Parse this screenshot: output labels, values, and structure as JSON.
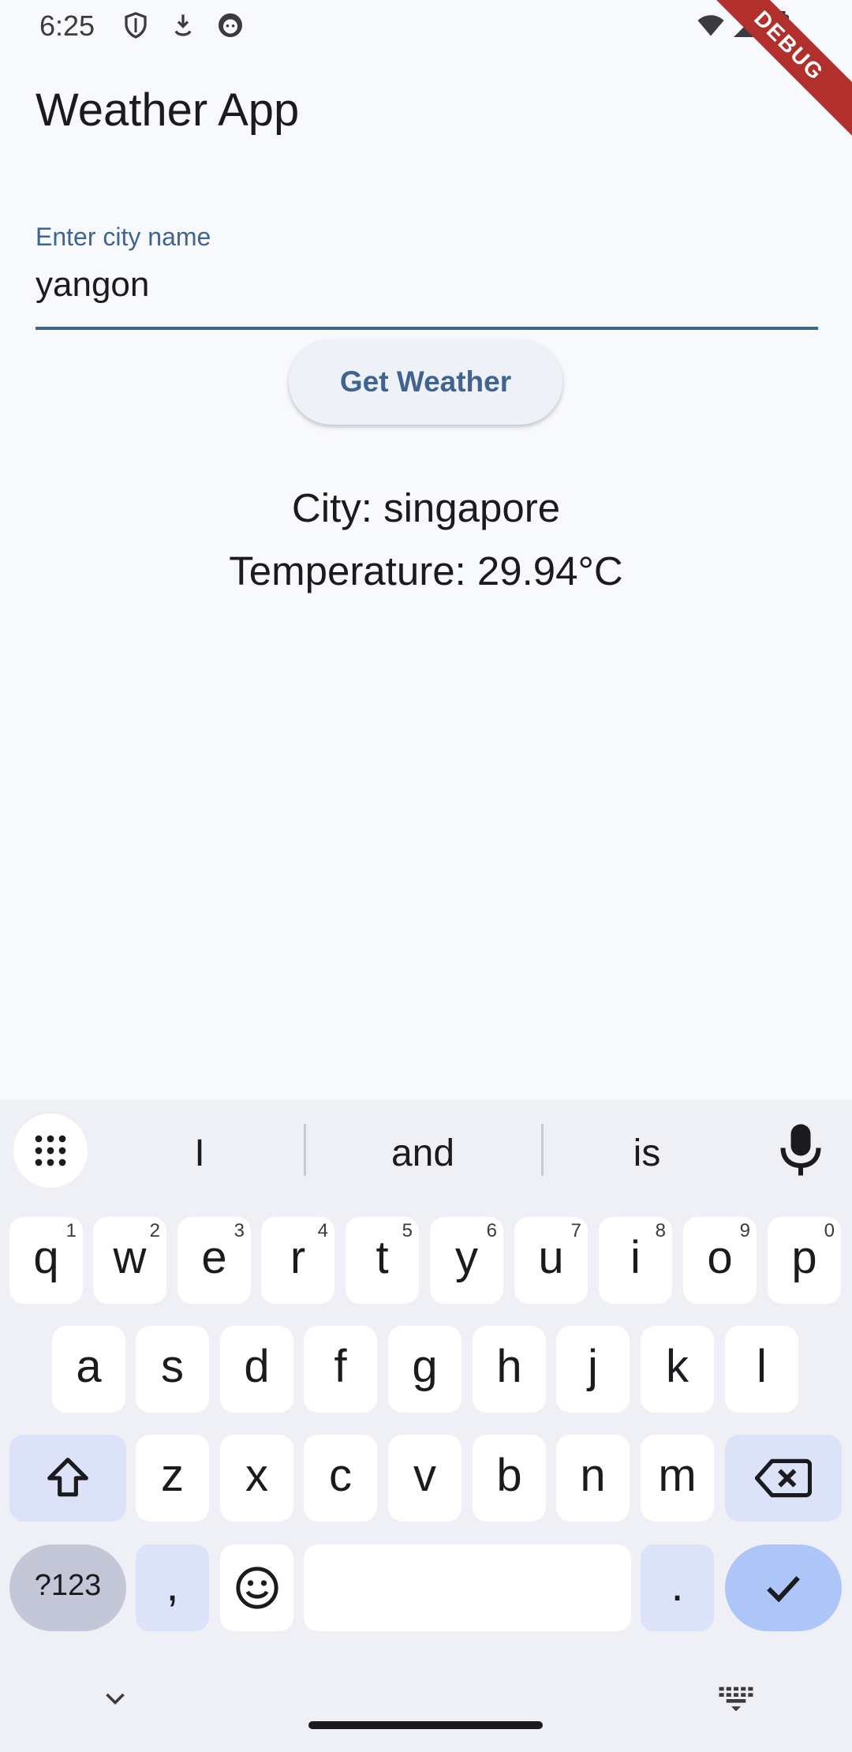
{
  "status": {
    "time": "6:25",
    "debug_banner": "DEBUG",
    "icons": [
      "shield-icon",
      "download-icon",
      "face-icon",
      "wifi-icon",
      "signal-icon",
      "battery-icon"
    ]
  },
  "app": {
    "title": "Weather App",
    "city_field": {
      "label": "Enter city name",
      "value": "yangon"
    },
    "button_label": "Get Weather",
    "result": {
      "city": "City: singapore",
      "temperature": "Temperature: 29.94°C"
    }
  },
  "keyboard": {
    "suggestions": [
      "I",
      "and",
      "is"
    ],
    "row1": [
      {
        "k": "q",
        "h": "1"
      },
      {
        "k": "w",
        "h": "2"
      },
      {
        "k": "e",
        "h": "3"
      },
      {
        "k": "r",
        "h": "4"
      },
      {
        "k": "t",
        "h": "5"
      },
      {
        "k": "y",
        "h": "6"
      },
      {
        "k": "u",
        "h": "7"
      },
      {
        "k": "i",
        "h": "8"
      },
      {
        "k": "o",
        "h": "9"
      },
      {
        "k": "p",
        "h": "0"
      }
    ],
    "row2": [
      "a",
      "s",
      "d",
      "f",
      "g",
      "h",
      "j",
      "k",
      "l"
    ],
    "row3": [
      "z",
      "x",
      "c",
      "v",
      "b",
      "n",
      "m"
    ],
    "symbols_key": "?123",
    "comma_key": ",",
    "period_key": "."
  },
  "colors": {
    "background": "#f8f9fd",
    "accent": "#3f6490",
    "keyboard_bg": "#eff0f6",
    "enter_key": "#aec5f7",
    "debug_banner": "#b2302c"
  }
}
